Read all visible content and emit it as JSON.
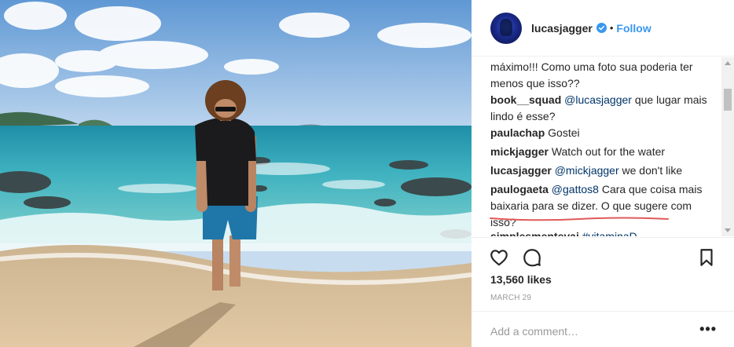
{
  "post": {
    "username": "lucasjagger",
    "follow_label": "Follow",
    "separator": "•"
  },
  "comments": [
    {
      "user": "",
      "text": "máximo!!! Como uma foto sua poderia ter menos que isso??"
    },
    {
      "user": "book__squad",
      "mention": "@lucasjagger",
      "text": " que lugar mais lindo é esse?"
    },
    {
      "user": "paulachap",
      "text": " Gostei"
    },
    {
      "user": "mickjagger",
      "text": " Watch out for the water"
    },
    {
      "user": "lucasjagger",
      "mention": "@mickjagger",
      "text": " we don't like"
    },
    {
      "user": "paulogaeta",
      "mention": "@gattos8",
      "text": " Cara que coisa mais baixaria para se dizer. O que sugere com isso?"
    },
    {
      "user": "simplesmenteyai",
      "tag": "#vitaminaD"
    }
  ],
  "stats": {
    "likes": "13,560 likes",
    "date": "MARCH 29"
  },
  "input": {
    "placeholder": "Add a comment…",
    "more_label": "•••"
  },
  "icons": {
    "verified": "verified-badge-icon",
    "like": "heart-icon",
    "comment": "comment-bubble-icon",
    "save": "bookmark-icon"
  },
  "colors": {
    "link": "#3897f0",
    "verified": "#3897f0",
    "underline": "#e05a5a"
  }
}
